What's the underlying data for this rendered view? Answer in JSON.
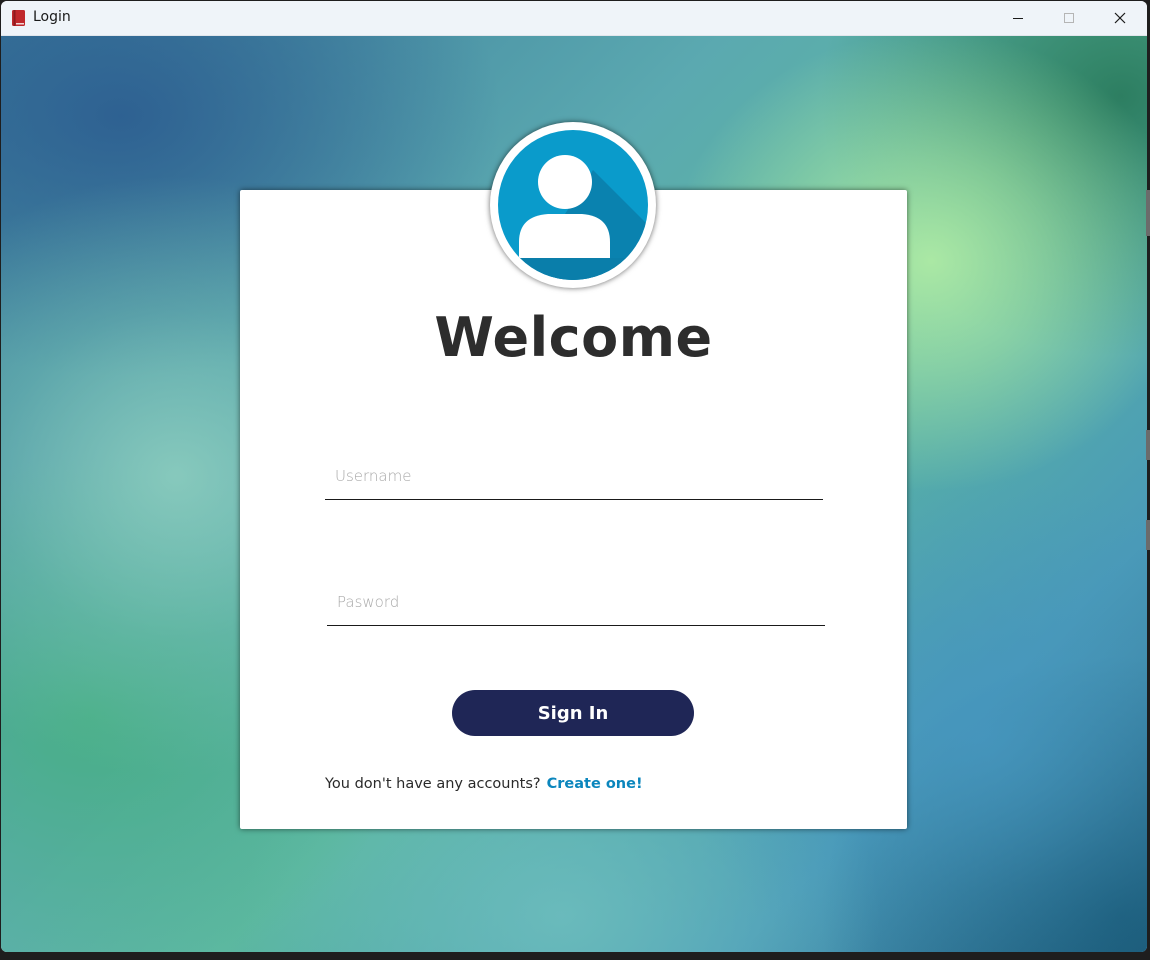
{
  "window": {
    "title": "Login",
    "app_icon": "red-book-icon"
  },
  "titlebar_controls": {
    "minimize_icon": "minimize-icon",
    "maximize_icon": "maximize-icon",
    "close_icon": "close-icon"
  },
  "login": {
    "avatar_icon": "user-avatar-icon",
    "heading": "Welcome",
    "username_placeholder": "Username",
    "password_placeholder": "Pasword",
    "signin_label": "Sign In",
    "no_account_text": "You don't have any accounts?",
    "create_link_label": "Create one!"
  },
  "colors": {
    "button_bg": "#1f2656",
    "link": "#0b86bd",
    "avatar_bg": "#0a9bcb",
    "heading": "#2d2d2d"
  }
}
